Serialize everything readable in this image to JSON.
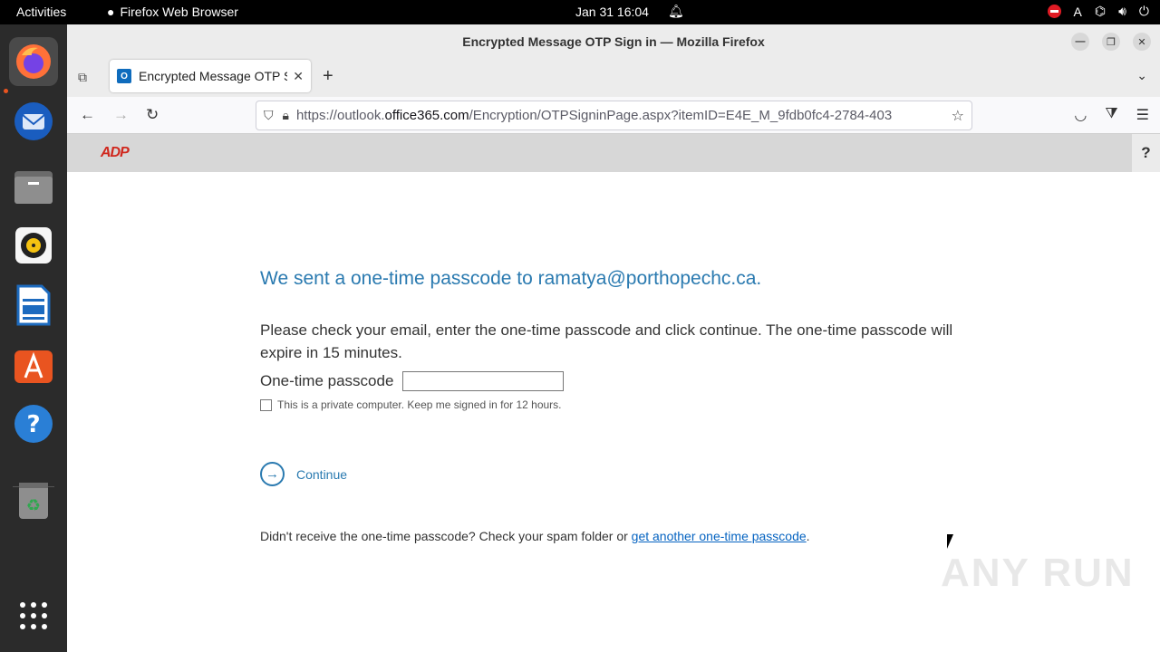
{
  "topbar": {
    "activities": "Activities",
    "app_name": "Firefox Web Browser",
    "clock": "Jan 31  16:04",
    "keyboard_indicator": "A"
  },
  "window": {
    "title": "Encrypted Message OTP Sign in — Mozilla Firefox"
  },
  "tab": {
    "title": "Encrypted Message OTP Sign in",
    "favicon_label": "O"
  },
  "urlbar": {
    "prefix": "https://outlook.",
    "domain": "office365.com",
    "path": "/Encryption/OTPSigninPage.aspx?itemID=E4E_M_9fdb0fc4-2784-403"
  },
  "page": {
    "logo": "ADP",
    "help": "?",
    "heading": "We sent a one-time passcode to ramatya@porthopechc.ca.",
    "instruction": "Please check your email, enter the one-time passcode and click continue. The one-time passcode will expire in 15 minutes.",
    "otp_label": "One-time passcode",
    "otp_value": "",
    "private_label": "This is a private computer. Keep me signed in for 12 hours.",
    "continue_label": "Continue",
    "resend_text": "Didn't receive the one-time passcode? Check your spam folder or ",
    "resend_link": "get another one-time passcode",
    "resend_suffix": "."
  },
  "watermark": "ANY RUN",
  "colors": {
    "accent": "#2a7ab0",
    "link": "#0563c1",
    "brand": "#d0271d"
  }
}
